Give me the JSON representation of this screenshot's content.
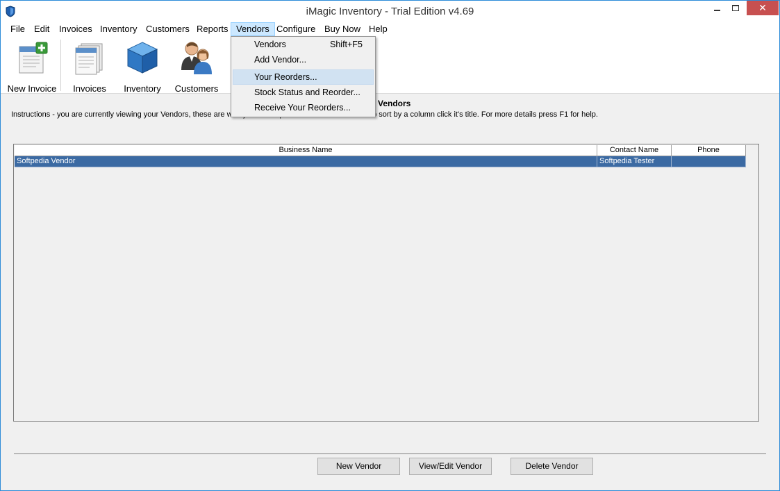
{
  "window": {
    "title": "iMagic Inventory - Trial Edition v4.69",
    "close_glyph": "✕"
  },
  "menubar": {
    "items": [
      {
        "label": "File"
      },
      {
        "label": "Edit"
      },
      {
        "label": "Invoices"
      },
      {
        "label": "Inventory"
      },
      {
        "label": "Customers"
      },
      {
        "label": "Reports"
      },
      {
        "label": "Vendors"
      },
      {
        "label": "Configure"
      },
      {
        "label": "Buy Now"
      },
      {
        "label": "Help"
      }
    ]
  },
  "toolbar": {
    "buttons": [
      {
        "label": "New Invoice",
        "icon": "new-invoice-icon"
      },
      {
        "label": "Invoices",
        "icon": "invoices-icon"
      },
      {
        "label": "Inventory",
        "icon": "inventory-box-icon"
      },
      {
        "label": "Customers",
        "icon": "customers-icon"
      }
    ]
  },
  "vendors_menu": {
    "items": [
      {
        "label": "Vendors",
        "shortcut": "Shift+F5"
      },
      {
        "label": "Add Vendor..."
      },
      {
        "label": "Your Reorders..."
      },
      {
        "label": "Stock Status and Reorder..."
      },
      {
        "label": "Receive Your Reorders..."
      }
    ]
  },
  "content": {
    "heading": "Vendors",
    "instructions": "Instructions - you are currently viewing your Vendors, these are who you would purchase new stock from. To sort by a column click it's title. For more details press F1 for help."
  },
  "table": {
    "columns": [
      "Business Name",
      "Contact Name",
      "Phone"
    ],
    "rows": [
      [
        "Softpedia Vendor",
        "Softpedia Tester",
        ""
      ]
    ]
  },
  "actions": {
    "new_vendor": "New Vendor",
    "view_edit_vendor": "View/Edit Vendor",
    "delete_vendor": "Delete Vendor"
  },
  "colors": {
    "selection": "#3b6aa3",
    "menu_highlight": "#cce8ff",
    "close_button": "#c75050"
  }
}
